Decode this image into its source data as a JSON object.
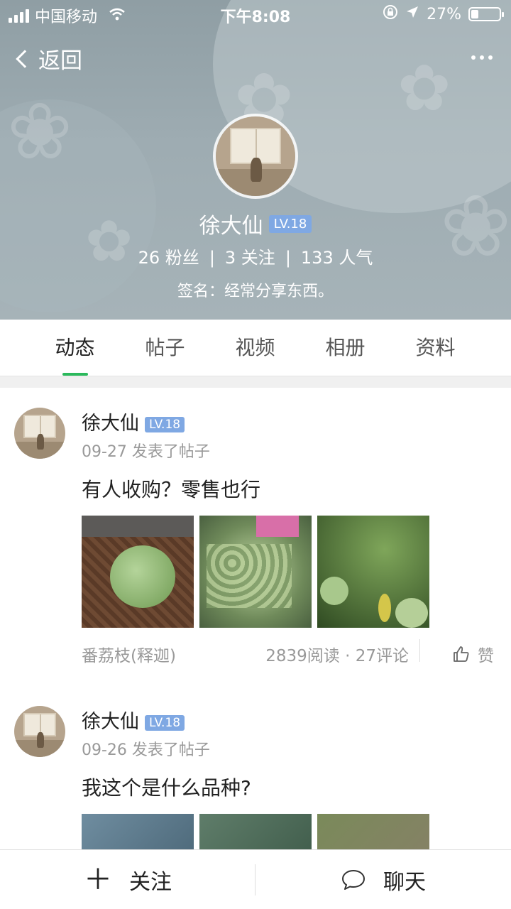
{
  "status": {
    "carrier": "中国移动",
    "time": "下午8:08",
    "battery": "27%",
    "battery_level": 0.27
  },
  "nav": {
    "back_label": "返回"
  },
  "profile": {
    "name": "徐大仙",
    "level": "LV.18",
    "fans": "26 粉丝",
    "following": "3 关注",
    "popularity": "133 人气",
    "separator": "|",
    "signature": "签名：经常分享东西。"
  },
  "tabs": [
    {
      "label": "动态",
      "active": true
    },
    {
      "label": "帖子"
    },
    {
      "label": "视频"
    },
    {
      "label": "相册"
    },
    {
      "label": "资料"
    }
  ],
  "posts": [
    {
      "author": "徐大仙",
      "level": "LV.18",
      "meta": "09-27 发表了帖子",
      "content": "有人收购？零售也行",
      "tag": "番荔枝(释迦)",
      "counts": "2839阅读 · 27评论",
      "like_label": "赞"
    },
    {
      "author": "徐大仙",
      "level": "LV.18",
      "meta": "09-26 发表了帖子",
      "content": "我这个是什么品种?"
    }
  ],
  "bottom": {
    "follow_label": "关注",
    "chat_label": "聊天"
  },
  "colors": {
    "accent_green": "#2bb95c",
    "level_badge": "#7fa8e3"
  }
}
